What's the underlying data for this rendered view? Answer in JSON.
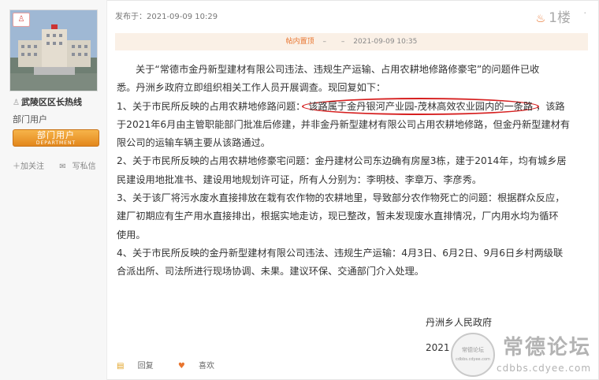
{
  "sidebar": {
    "user_name": "武陵区区长热线",
    "user_group": "部门用户",
    "badge_cn": "部门用户",
    "badge_en": "DEPARTMENT",
    "add_follow": "加关注",
    "send_message": "写私信"
  },
  "post": {
    "posted_at": "发布于：2021-09-09 10:29",
    "floor": "1楼",
    "more": "·",
    "edit_bar": {
      "link": "帖内置顶",
      "sep": "–",
      "date": "2021-09-09 10:35"
    },
    "lines": [
      "关于“常德市金丹新型建材有限公司违法、违规生产运输、占用农耕地修路修豪宅”的问题件已收",
      "悉。丹洲乡政府立即组织相关工作人员开展调查。现回复如下：",
      "1、关于市民所反映的占用农耕地修路问题：",
      "该路属于金丹银河产业园-茂林高效农业园内的一条路",
      "，该路",
      "于2021年6月由主管职能部门批准后修建，并非金丹新型建材有限公司占用农耕地修路，但金丹新型建材有",
      "限公司的运输车辆主要从该路通过。",
      "2、关于市民所反映的占用农耕地修豪宅问题：金丹建材公司东边确有房屋3栋，建于2014年，均有城乡居",
      "民建设用地批准书、建设用地规划许可证，所有人分别为：李明枝、李章万、李彦秀。",
      "3、关于该厂将污水废水直接排放在栽有农作物的农耕地里，导致部分农作物死亡的问题：根据群众反应，",
      "建厂初期应有生产用水直接排出，根据实地走访，现已整改，暂未发现废水直排情况，厂内用水均为循环",
      "使用。",
      "4、关于市民所反映的金丹新型建材有限公司违法、违规生产运输：4月3日、6月2日、9月6日乡村两级联",
      "合派出所、司法所进行现场协调、未果。建议环保、交通部门介入处理。"
    ],
    "signature": "丹洲乡人民政府",
    "sign_year": "2021",
    "reply": "回复",
    "like": "喜欢"
  },
  "watermark": {
    "title": "常德论坛",
    "url": "cdbbs.cdyee.com",
    "seal_text": "常德论坛",
    "seal_sub": "cdbbs.cdyee.com"
  },
  "colors": {
    "accent": "#e8742e",
    "highlight_circle": "#d62020",
    "badge_orange": "#f0a030"
  }
}
